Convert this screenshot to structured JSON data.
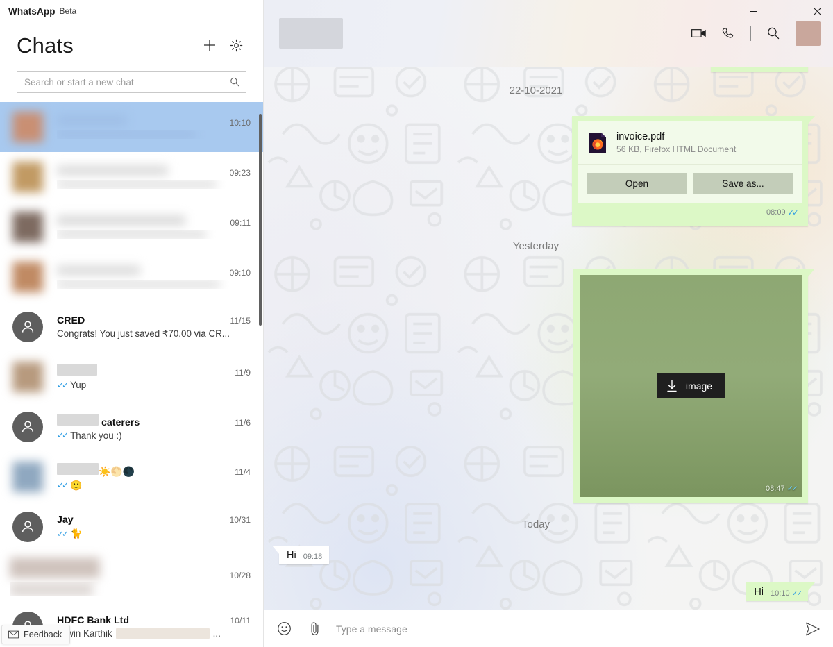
{
  "window": {
    "brand": "WhatsApp",
    "brand_tag": "Beta",
    "minimize_label": "Minimize",
    "maximize_label": "Maximize",
    "close_label": "Close"
  },
  "sidebar": {
    "title": "Chats",
    "new_chat_label": "New chat",
    "settings_label": "Settings",
    "search": {
      "placeholder": "Search or start a new chat",
      "value": ""
    },
    "feedback_label": "Feedback",
    "chats": [
      {
        "name": "",
        "preview": "",
        "time": "10:10",
        "redacted": true,
        "selected": true,
        "avatar_tint": "#c98f73"
      },
      {
        "name": "",
        "preview": "",
        "time": "09:23",
        "redacted": true,
        "selected": false,
        "avatar_tint": "#c19a63"
      },
      {
        "name": "",
        "preview": "",
        "time": "09:11",
        "redacted": true,
        "selected": false,
        "avatar_tint": "#7d6a60"
      },
      {
        "name": "",
        "preview": "",
        "time": "09:10",
        "redacted": true,
        "selected": false,
        "avatar_tint": "#c08a63"
      },
      {
        "name": "CRED",
        "preview": "Congrats! You just saved ₹70.00 via CR...",
        "time": "11/15",
        "redacted": false,
        "selected": false,
        "ticks": false,
        "avatar": "person"
      },
      {
        "name": "",
        "preview": "Yup",
        "time": "11/9",
        "redacted": false,
        "selected": false,
        "ticks": true,
        "name_redacted": true,
        "avatar": "photo",
        "avatar_tint": "#b79a7e"
      },
      {
        "name": "caterers",
        "preview": "Thank you :)",
        "time": "11/6",
        "redacted": false,
        "selected": false,
        "ticks": true,
        "name_prefix_redacted": true,
        "avatar": "person"
      },
      {
        "name": "",
        "preview": "🙂",
        "time": "11/4",
        "redacted": false,
        "selected": false,
        "ticks": true,
        "name_redacted": true,
        "name_emoji": "☀️🌕🌑",
        "avatar": "photo",
        "avatar_tint": "#8fa8c0"
      },
      {
        "name": "Jay",
        "preview": "🐈",
        "time": "10/31",
        "redacted": false,
        "selected": false,
        "ticks": true,
        "avatar": "person"
      },
      {
        "name": "",
        "preview": "",
        "time": "10/28",
        "redacted": true,
        "selected": false,
        "avatar_tint": "#b89a8c"
      },
      {
        "name": "HDFC Bank Ltd",
        "preview": "shwin Karthik",
        "time": "10/11",
        "redacted": false,
        "selected": false,
        "ticks": false,
        "avatar": "person",
        "preview_trailing": "..."
      }
    ]
  },
  "chat_header": {
    "contact_name": "",
    "contact_name_redacted": true,
    "video_call_label": "Video call",
    "voice_call_label": "Voice call",
    "search_label": "Search",
    "profile_label": "Profile"
  },
  "conversation": {
    "separators": {
      "first": "22-10-2021",
      "second": "Yesterday",
      "third": "Today"
    },
    "document_message": {
      "file_name": "invoice.pdf",
      "file_meta": "56 KB, Firefox HTML Document",
      "open_label": "Open",
      "save_label": "Save as...",
      "time": "08:09",
      "status": "read"
    },
    "image_message": {
      "download_label": "image",
      "time": "08:47",
      "status": "read"
    },
    "incoming_text": {
      "text": "Hi",
      "time": "09:18"
    },
    "outgoing_text": {
      "text": "Hi",
      "time": "10:10",
      "status": "read"
    }
  },
  "composer": {
    "emoji_label": "Emoji",
    "attach_label": "Attach",
    "placeholder": "Type a message",
    "value": "",
    "send_label": "Send"
  },
  "colors": {
    "outgoing_bubble": "#dcf8c6",
    "incoming_bubble": "#ffffff",
    "selected_row": "#a8c9ef",
    "tick_blue": "#2f9de3",
    "accent_close": "#e81123"
  }
}
